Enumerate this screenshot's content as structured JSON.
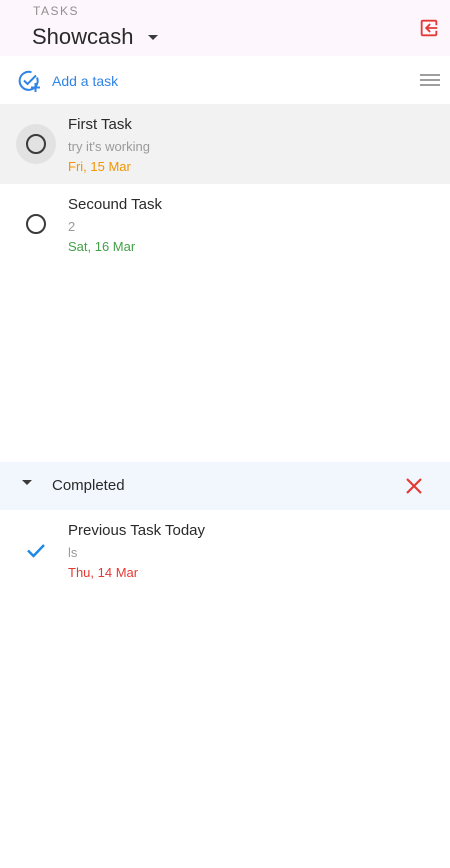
{
  "header": {
    "overline": "TASKS",
    "list_name": "Showcash",
    "background": "#fdf6fd",
    "logout_icon": "exit-to-app-icon",
    "logout_color": "#e53935"
  },
  "toolbar": {
    "add_task_label": "Add a task",
    "add_task_icon": "add-task-icon",
    "menu_icon": "menu-icon",
    "accent": "#2f84e6"
  },
  "tasks": [
    {
      "title": "First Task",
      "notes": "try it's working",
      "due": "Fri, 15 Mar",
      "due_color": "#f29500",
      "selected": true
    },
    {
      "title": "Secound Task",
      "notes": "2",
      "due": "Sat, 16 Mar",
      "due_color": "#43a047",
      "selected": false
    }
  ],
  "completed": {
    "label": "Completed",
    "expanded": true,
    "clear_icon": "close-icon",
    "clear_color": "#e53935",
    "background": "#f1f7fd",
    "items": [
      {
        "title": "Previous Task Today",
        "notes": "ls",
        "due": "Thu, 14 Mar",
        "due_color": "#e53935",
        "check_color": "#1e88e5"
      }
    ]
  }
}
